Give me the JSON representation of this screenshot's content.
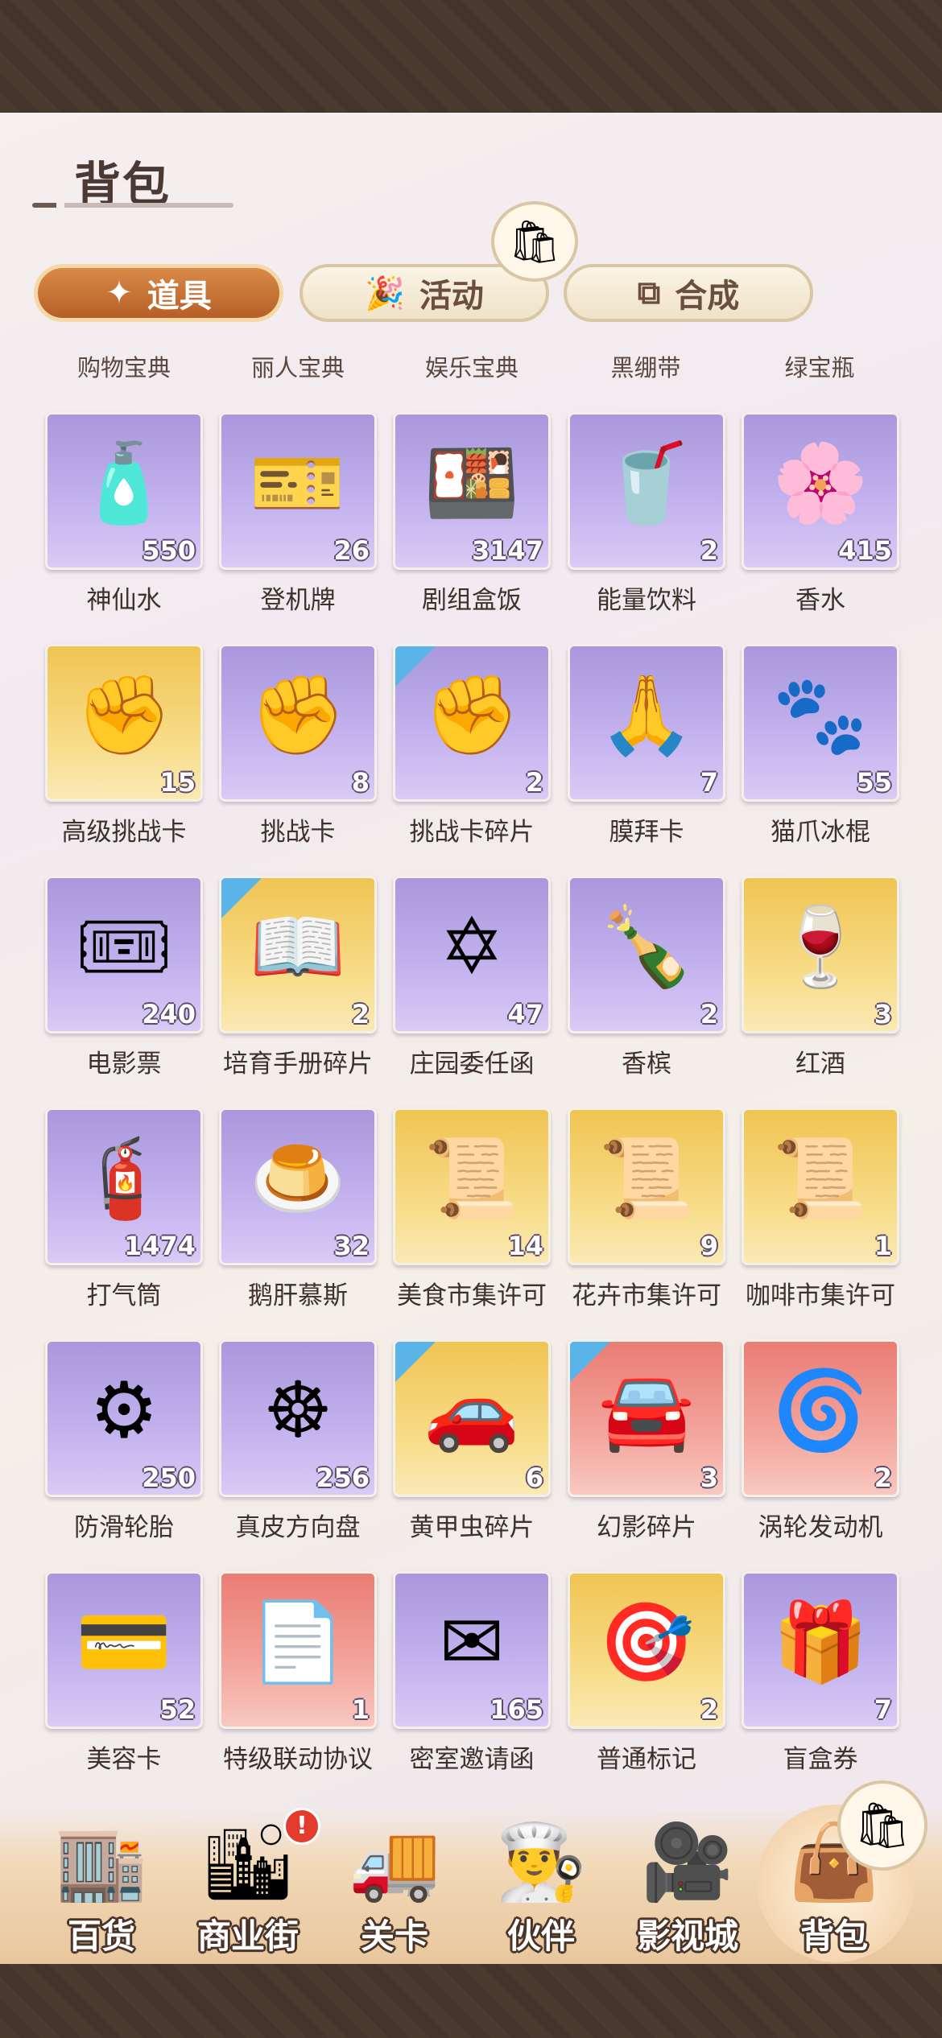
{
  "page": {
    "title": "背包"
  },
  "tabs": [
    {
      "label": "道具",
      "icon": "wand-icon",
      "glyph": "✦"
    },
    {
      "label": "活动",
      "icon": "party-popper-icon",
      "glyph": "🎉"
    },
    {
      "label": "合成",
      "icon": "merge-icon",
      "glyph": "⧉"
    }
  ],
  "subcategories": [
    "购物宝典",
    "丽人宝典",
    "娱乐宝典",
    "黑绷带",
    "绿宝瓶"
  ],
  "items": [
    {
      "name": "神仙水",
      "count": "550",
      "bg": "purple",
      "glyph": "🧴",
      "fragment": false
    },
    {
      "name": "登机牌",
      "count": "26",
      "bg": "purple",
      "glyph": "🎫",
      "fragment": false
    },
    {
      "name": "剧组盒饭",
      "count": "3147",
      "bg": "purple",
      "glyph": "🍱",
      "fragment": false
    },
    {
      "name": "能量饮料",
      "count": "2",
      "bg": "purple",
      "glyph": "🥤",
      "fragment": false
    },
    {
      "name": "香水",
      "count": "415",
      "bg": "purple",
      "glyph": "🌸",
      "fragment": false
    },
    {
      "name": "高级挑战卡",
      "count": "15",
      "bg": "gold",
      "glyph": "✊",
      "fragment": false
    },
    {
      "name": "挑战卡",
      "count": "8",
      "bg": "purple",
      "glyph": "✊",
      "fragment": false
    },
    {
      "name": "挑战卡碎片",
      "count": "2",
      "bg": "purple",
      "glyph": "✊",
      "fragment": true
    },
    {
      "name": "膜拜卡",
      "count": "7",
      "bg": "purple",
      "glyph": "🙏",
      "fragment": false
    },
    {
      "name": "猫爪冰棍",
      "count": "55",
      "bg": "purple",
      "glyph": "🐾",
      "fragment": false
    },
    {
      "name": "电影票",
      "count": "240",
      "bg": "purple",
      "glyph": "🎟",
      "fragment": false
    },
    {
      "name": "培育手册碎片",
      "count": "2",
      "bg": "gold",
      "glyph": "📖",
      "fragment": true
    },
    {
      "name": "庄园委任函",
      "count": "47",
      "bg": "purple",
      "glyph": "✡",
      "fragment": false
    },
    {
      "name": "香槟",
      "count": "2",
      "bg": "purple",
      "glyph": "🍾",
      "fragment": false
    },
    {
      "name": "红酒",
      "count": "3",
      "bg": "gold",
      "glyph": "🍷",
      "fragment": false
    },
    {
      "name": "打气筒",
      "count": "1474",
      "bg": "purple",
      "glyph": "🧯",
      "fragment": false
    },
    {
      "name": "鹅肝慕斯",
      "count": "32",
      "bg": "purple",
      "glyph": "🍮",
      "fragment": false
    },
    {
      "name": "美食市集许可",
      "count": "14",
      "bg": "gold",
      "glyph": "📜",
      "fragment": false
    },
    {
      "name": "花卉市集许可",
      "count": "9",
      "bg": "gold",
      "glyph": "📜",
      "fragment": false
    },
    {
      "name": "咖啡市集许可",
      "count": "1",
      "bg": "gold",
      "glyph": "📜",
      "fragment": false
    },
    {
      "name": "防滑轮胎",
      "count": "250",
      "bg": "purple",
      "glyph": "⚙",
      "fragment": false
    },
    {
      "name": "真皮方向盘",
      "count": "256",
      "bg": "purple",
      "glyph": "☸",
      "fragment": false
    },
    {
      "name": "黄甲虫碎片",
      "count": "6",
      "bg": "gold",
      "glyph": "🚗",
      "fragment": true
    },
    {
      "name": "幻影碎片",
      "count": "3",
      "bg": "red",
      "glyph": "🚘",
      "fragment": true
    },
    {
      "name": "涡轮发动机",
      "count": "2",
      "bg": "red",
      "glyph": "🌀",
      "fragment": false
    },
    {
      "name": "美容卡",
      "count": "52",
      "bg": "purple",
      "glyph": "💳",
      "fragment": false
    },
    {
      "name": "特级联动协议",
      "count": "1",
      "bg": "red",
      "glyph": "📄",
      "fragment": false
    },
    {
      "name": "密室邀请函",
      "count": "165",
      "bg": "purple",
      "glyph": "✉",
      "fragment": false
    },
    {
      "name": "普通标记",
      "count": "2",
      "bg": "gold",
      "glyph": "🎯",
      "fragment": false
    },
    {
      "name": "盲盒券",
      "count": "7",
      "bg": "purple",
      "glyph": "🎁",
      "fragment": false
    }
  ],
  "bottom_nav": [
    {
      "label": "百货",
      "icon": "department-store-icon",
      "glyph": "🏬"
    },
    {
      "label": "商业街",
      "icon": "commercial-street-icon",
      "glyph": "🏙",
      "badge": "!"
    },
    {
      "label": "关卡",
      "icon": "truck-icon",
      "glyph": "🚚"
    },
    {
      "label": "伙伴",
      "icon": "partner-chef-icon",
      "glyph": "👨‍🍳"
    },
    {
      "label": "影视城",
      "icon": "film-camera-icon",
      "glyph": "🎥"
    },
    {
      "label": "背包",
      "icon": "handbag-icon",
      "glyph": "👜",
      "active": true
    }
  ],
  "colors": {
    "accent": "#c9733a",
    "badge": "#e33b2e",
    "fragment_corner": "#5ab4e8"
  }
}
